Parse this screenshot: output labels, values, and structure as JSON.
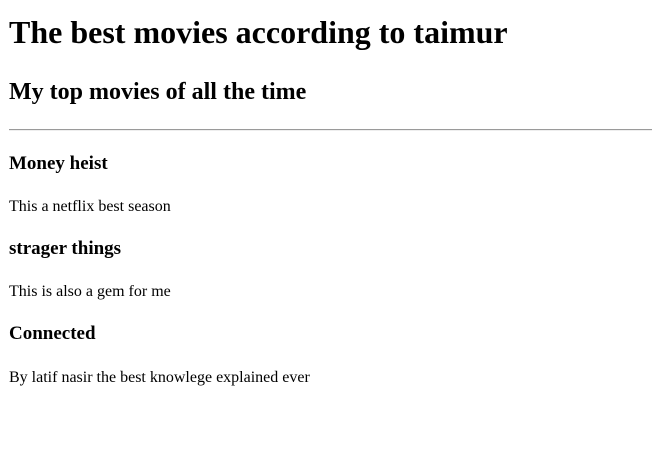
{
  "page": {
    "title": "The best movies according to taimur",
    "subtitle": "My top movies of all the time"
  },
  "movies": [
    {
      "title": "Money heist",
      "description": "This a netflix best season"
    },
    {
      "title": "strager things",
      "description": "This is also a gem for me"
    },
    {
      "title": "Connected",
      "description": "By latif nasir the best knowlege explained ever"
    }
  ]
}
